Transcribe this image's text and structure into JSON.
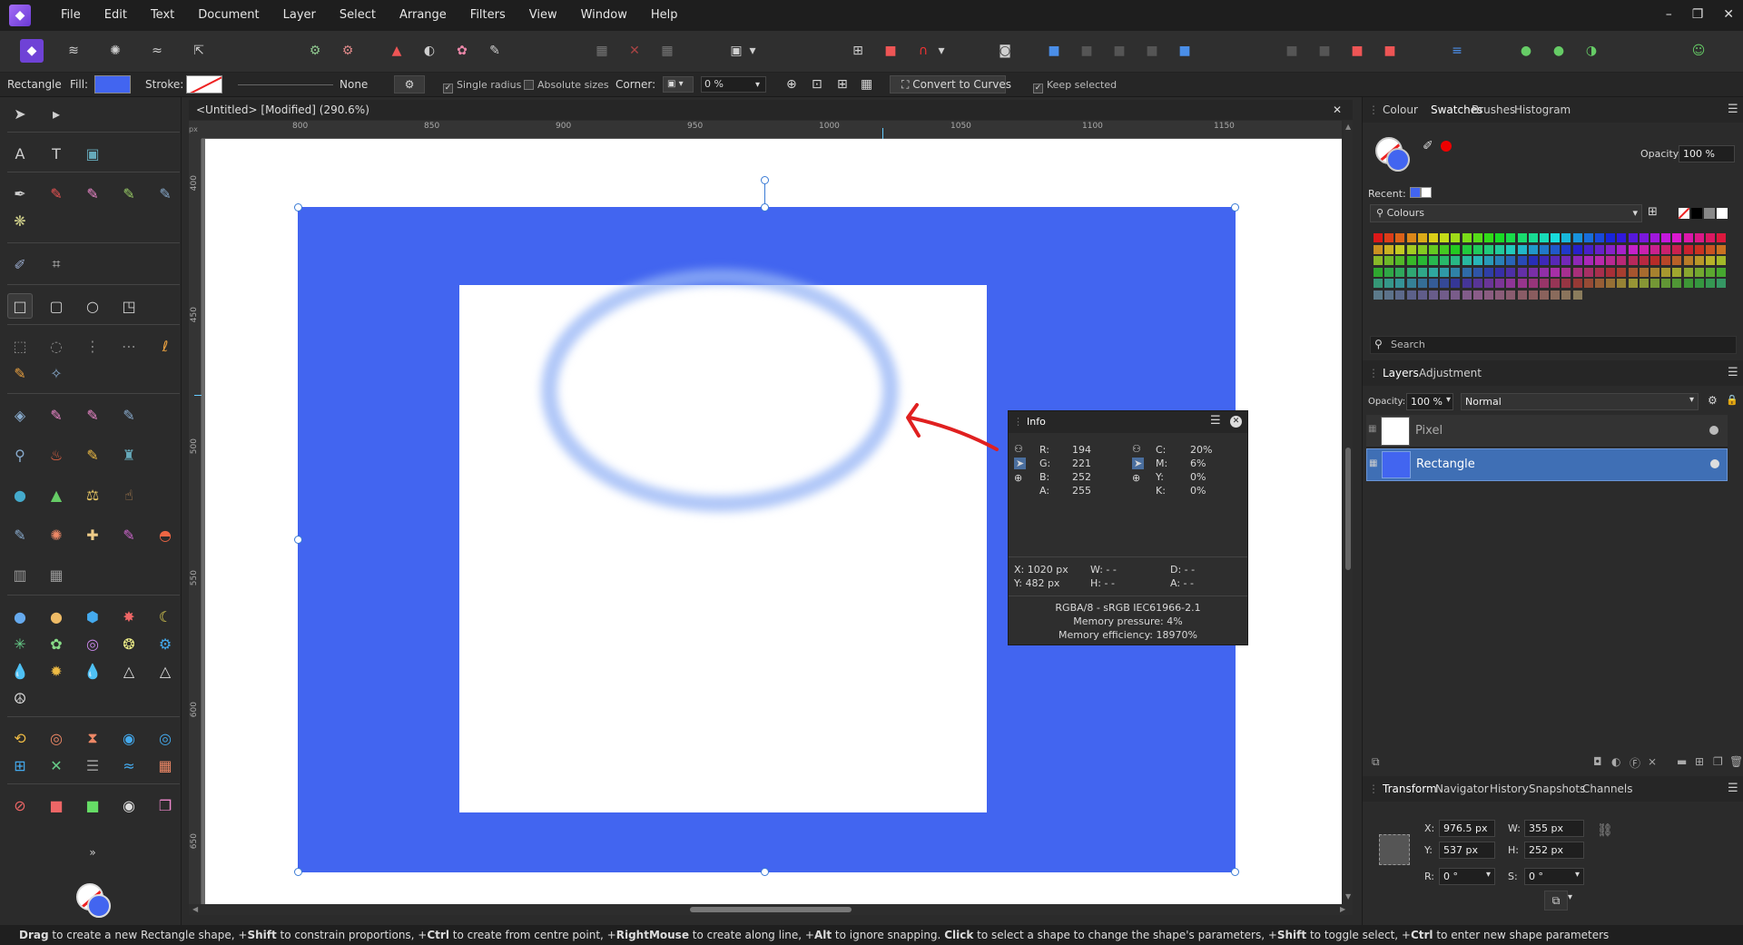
{
  "menu": {
    "items": [
      "File",
      "Edit",
      "Text",
      "Document",
      "Layer",
      "Select",
      "Arrange",
      "Filters",
      "View",
      "Window",
      "Help"
    ]
  },
  "window_controls": {
    "minimize": "–",
    "restore": "❐",
    "close": "✕"
  },
  "context": {
    "tool_name": "Rectangle",
    "fill_label": "Fill:",
    "fill_color": "#4265f0",
    "stroke_label": "Stroke:",
    "stroke_value": "None",
    "single_radius": "Single radius",
    "absolute_sizes": "Absolute sizes",
    "corner_label": "Corner:",
    "corner_value": "0 %",
    "convert": "Convert to Curves",
    "keep_selected": "Keep selected"
  },
  "document": {
    "tab_title": "<Untitled> [Modified] (290.6%)",
    "close": "✕"
  },
  "ruler": {
    "unit": "px",
    "h_ticks": [
      "800",
      "850",
      "900",
      "950",
      "1000",
      "1050",
      "1100",
      "1150"
    ],
    "v_ticks": [
      "400",
      "450",
      "500",
      "550",
      "600",
      "650"
    ]
  },
  "info": {
    "title": "Info",
    "r_label": "R:",
    "r": "194",
    "g_label": "G:",
    "g": "221",
    "b_label": "B:",
    "b": "252",
    "a_label": "A:",
    "a": "255",
    "c_label": "C:",
    "c": "20%",
    "m_label": "M:",
    "m": "6%",
    "y_label": "Y:",
    "y": "0%",
    "k_label": "K:",
    "k": "0%",
    "x": "X: 1020 px",
    "ypos": "Y: 482 px",
    "w": "W: - -",
    "h": "H: - -",
    "d": "D: - -",
    "ang": "A: - -",
    "profile": "RGBA/8 - sRGB IEC61966-2.1",
    "pressure": "Memory pressure: 4%",
    "efficiency": "Memory efficiency: 18970%"
  },
  "colour_panel": {
    "tabs": [
      "Colour",
      "Swatches",
      "Brushes",
      "Histogram"
    ],
    "opacity_label": "Opacity:",
    "opacity": "100 %",
    "recent_label": "Recent:",
    "palette": "Colours",
    "search_placeholder": "Search"
  },
  "layers": {
    "tabs": [
      "Layers",
      "Adjustment"
    ],
    "opacity_label": "Opacity:",
    "opacity": "100 %",
    "blend": "Normal",
    "items": [
      {
        "name": "Pixel"
      },
      {
        "name": "Rectangle"
      }
    ]
  },
  "transform": {
    "tabs": [
      "Transform",
      "Navigator",
      "History",
      "Snapshots",
      "Channels"
    ],
    "x_label": "X:",
    "x": "976.5 px",
    "w_label": "W:",
    "w": "355 px",
    "y_label": "Y:",
    "y": "537 px",
    "h_label": "H:",
    "h": "252 px",
    "r_label": "R:",
    "r": "0 °",
    "s_label": "S:",
    "s": "0 °"
  },
  "status": {
    "drag": "Drag",
    "t1": " to create a new Rectangle shape, +",
    "shift1": "Shift",
    "t2": " to constrain proportions, +",
    "ctrl1": "Ctrl",
    "t3": " to create from centre point, +",
    "rmouse": "RightMouse",
    "t4": " to create along line, +",
    "alt": "Alt",
    "t5": " to ignore snapping. ",
    "click": "Click",
    "t6": " to select a shape to change the shape's parameters, +",
    "shift2": "Shift",
    "t7": " to toggle select, +",
    "ctrl2": "Ctrl",
    "t8": " to enter new shape parameters"
  },
  "colors": {
    "accent": "#4265f0",
    "selection": "#3f6fb5",
    "annotation_arrow": "#e02020"
  }
}
